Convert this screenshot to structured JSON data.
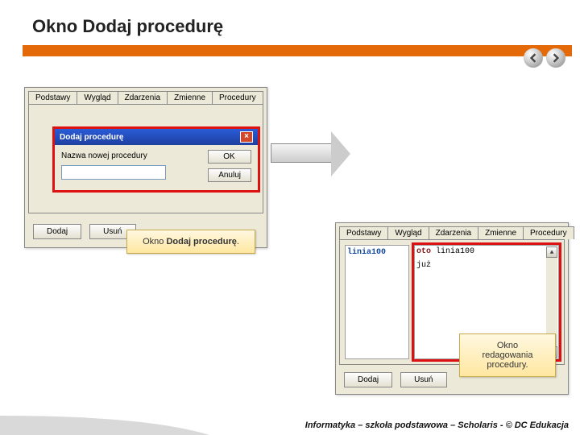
{
  "slide_title": "Okno Dodaj procedurę",
  "tabs": [
    "Podstawy",
    "Wygląd",
    "Zdarzenia",
    "Zmienne",
    "Procedury"
  ],
  "dialog": {
    "title": "Dodaj procedurę",
    "field_label": "Nazwa nowej procedury",
    "ok": "OK",
    "cancel": "Anuluj"
  },
  "buttons": {
    "add": "Dodaj",
    "remove": "Usuń"
  },
  "callout_left": "Okno Dodaj procedurę.",
  "callout_left_strong": "Dodaj procedurę",
  "callout_right_line1": "Okno redagowania",
  "callout_right_line2": "procedury.",
  "proc_name": "linia100",
  "code_line1_kw": "oto",
  "code_line1_rest": " linia100",
  "code_line2": "już",
  "footer": "Informatyka – szkoła podstawowa – Scholaris - © DC Edukacja"
}
